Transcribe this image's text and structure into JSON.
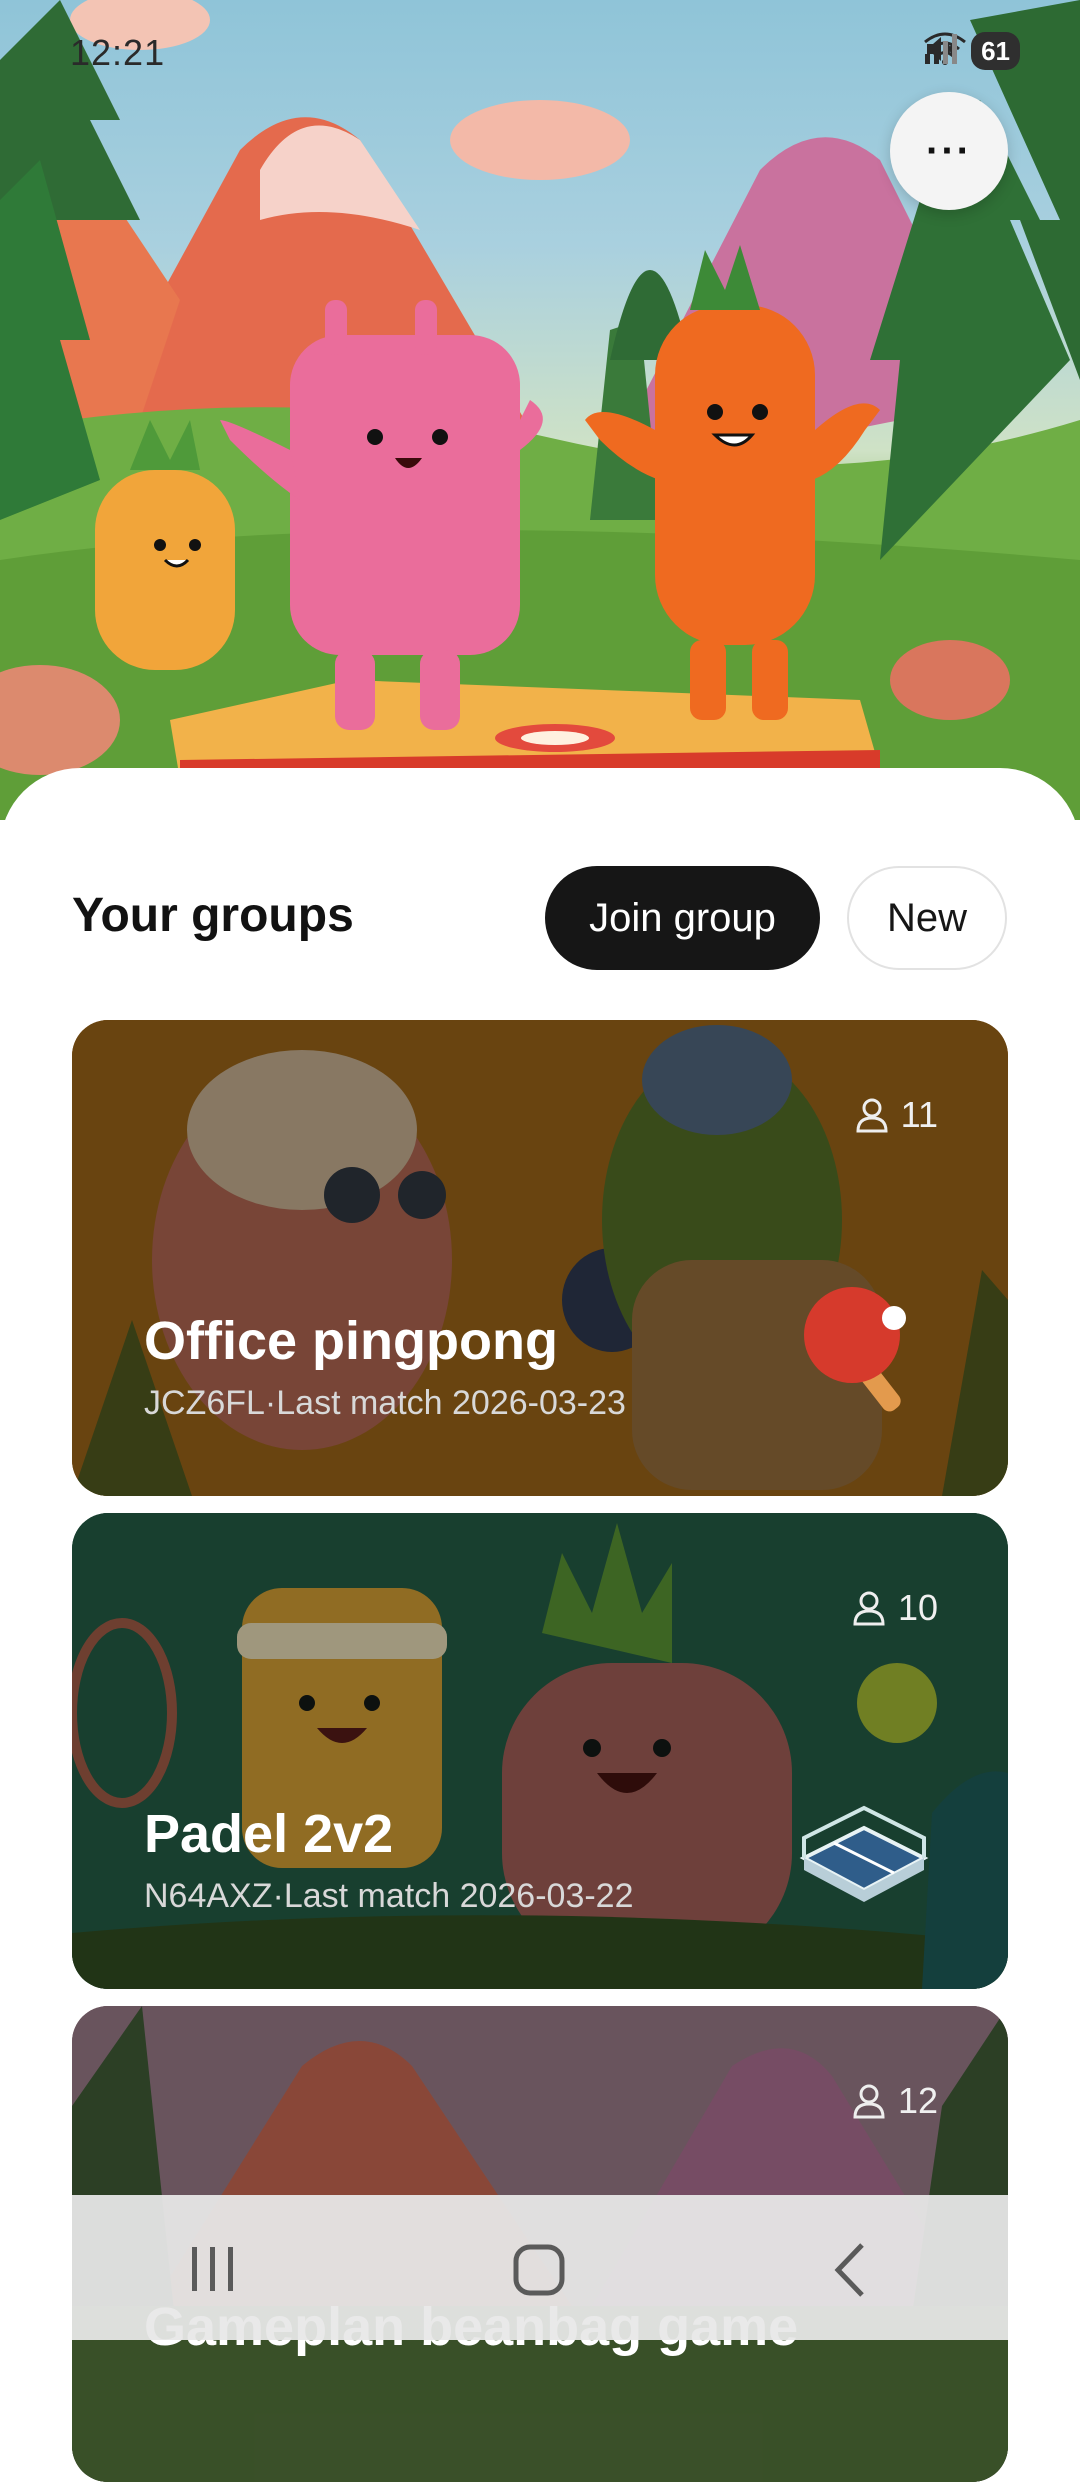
{
  "status_bar": {
    "time": "12:21",
    "battery": "61",
    "icons": [
      "mute-icon",
      "wifi-6e-icon",
      "signal-icon",
      "battery-icon"
    ]
  },
  "header": {
    "more_label": "···"
  },
  "groups_section": {
    "title": "Your groups",
    "join_label": "Join group",
    "new_label": "New"
  },
  "groups": [
    {
      "name": "Office pingpong",
      "code": "JCZ6FL",
      "separator": " · ",
      "last_match": "Last match 2026-03-23",
      "members": "11",
      "icon": "pingpong-paddle-icon",
      "accent": "#c9852e"
    },
    {
      "name": "Padel 2v2",
      "code": "N64AXZ",
      "separator": " · ",
      "last_match": "Last match 2026-03-22",
      "members": "10",
      "icon": "padel-court-icon",
      "accent": "#2f6b52"
    },
    {
      "name": "Gameplan beanbag game",
      "code": "",
      "separator": "",
      "last_match": "",
      "members": "12",
      "icon": "beanbag-board-icon",
      "accent": "#7a5a6a"
    }
  ],
  "nav": {
    "items": [
      "recents-icon",
      "home-icon",
      "back-icon"
    ]
  }
}
